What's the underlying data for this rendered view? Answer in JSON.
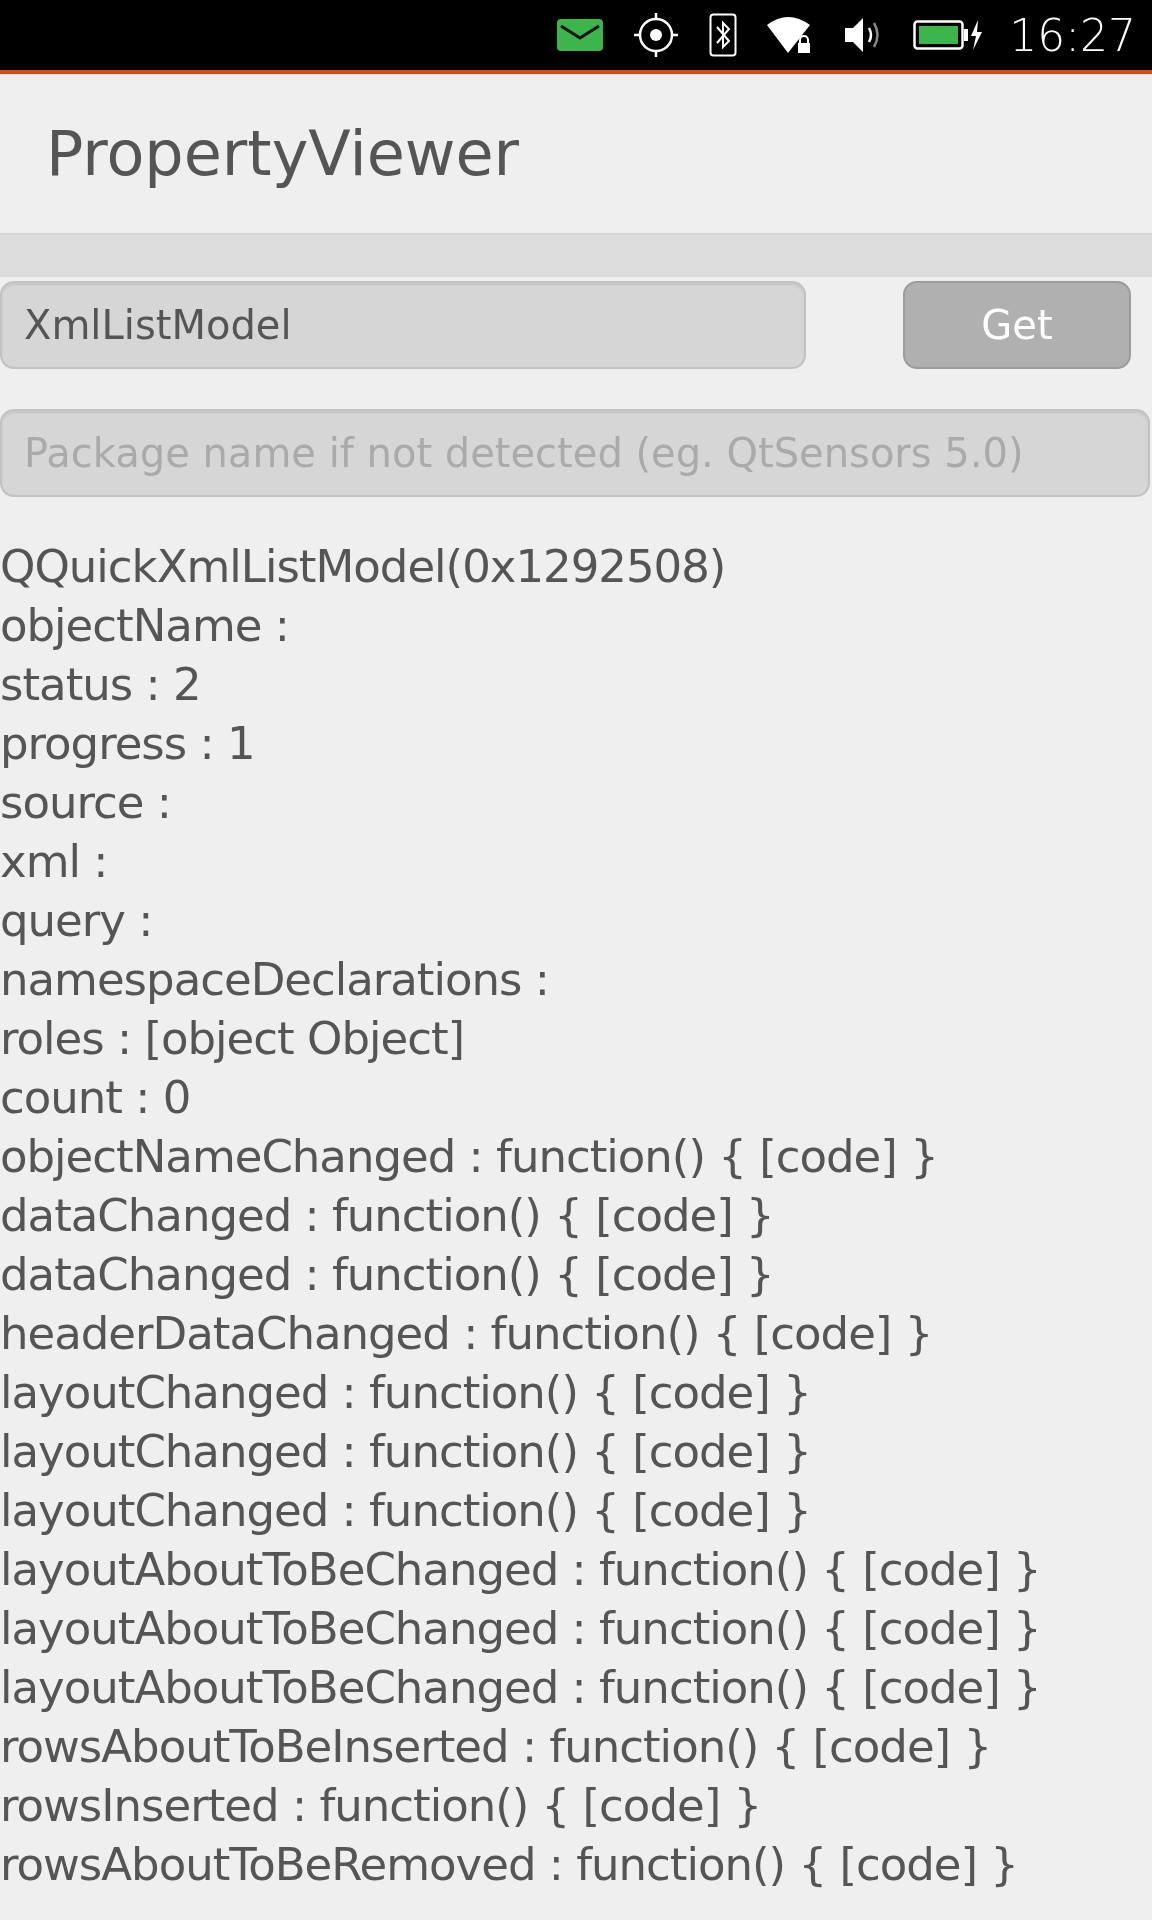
{
  "status_bar": {
    "time": "16:27"
  },
  "header": {
    "title": "PropertyViewer"
  },
  "type_field": {
    "value": "XmlListModel"
  },
  "get_button": {
    "label": "Get"
  },
  "package_field": {
    "placeholder": "Package name if not detected (eg. QtSensors 5.0)"
  },
  "properties": [
    "QQuickXmlListModel(0x1292508)",
    "objectName :",
    "status : 2",
    "progress : 1",
    "source :",
    "xml :",
    "query :",
    "namespaceDeclarations :",
    "roles : [object Object]",
    "count : 0",
    "objectNameChanged : function() { [code] }",
    "dataChanged : function() { [code] }",
    "dataChanged : function() { [code] }",
    "headerDataChanged : function() { [code] }",
    "layoutChanged : function() { [code] }",
    "layoutChanged : function() { [code] }",
    "layoutChanged : function() { [code] }",
    "layoutAboutToBeChanged : function() { [code] }",
    "layoutAboutToBeChanged : function() { [code] }",
    "layoutAboutToBeChanged : function() { [code] }",
    "rowsAboutToBeInserted : function() { [code] }",
    "rowsInserted : function() { [code] }",
    "rowsAboutToBeRemoved : function() { [code] }"
  ]
}
